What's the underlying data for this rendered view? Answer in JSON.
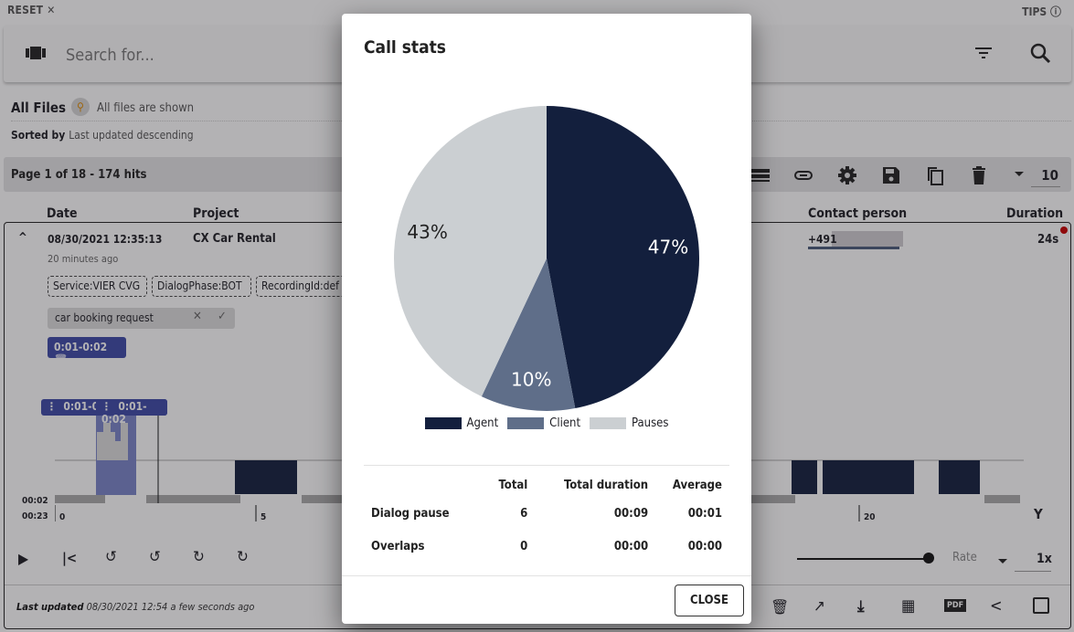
{
  "header": {
    "reset_label": "RESET",
    "tips_label": "TIPS"
  },
  "search": {
    "placeholder": "Search for..."
  },
  "files": {
    "title": "All Files",
    "status": "All files are shown",
    "sorted_by_label": "Sorted by",
    "sorted_by_value": "Last updated descending"
  },
  "pagination": {
    "summary": "Page 1 of 18 - 174 hits",
    "page_size": "10"
  },
  "table": {
    "columns": [
      "Date",
      "Project",
      "Contact person",
      "Duration"
    ],
    "row": {
      "date": "08/30/2021 12:35:13",
      "relative_time": "20 minutes ago",
      "project": "CX Car Rental",
      "contact": "+491",
      "duration": "24s",
      "chips": [
        "Service:VIER CVG",
        "DialogPhase:BOT",
        "RecordingId:def"
      ],
      "tag_text": "car  booking request",
      "segment": "0:01-0:02",
      "segment_marker": "0:01-0:02"
    }
  },
  "timeline": {
    "time_top": "00:02",
    "time_bottom": "00:23",
    "ticks": [
      "0",
      "5",
      "20"
    ]
  },
  "player": {
    "rate_label": "Rate",
    "rate_value": "1x",
    "volume": 1.0
  },
  "footer": {
    "last_updated_label": "Last updated",
    "last_updated_value": "08/30/2021 12:54 a few seconds ago"
  },
  "modal": {
    "title": "Call stats",
    "close_label": "CLOSE",
    "table": {
      "headers": [
        "",
        "Total",
        "Total duration",
        "Average"
      ],
      "rows": [
        {
          "label": "Dialog pause",
          "total": "6",
          "duration": "00:09",
          "average": "00:01"
        },
        {
          "label": "Overlaps",
          "total": "0",
          "duration": "00:00",
          "average": "00:00"
        }
      ]
    }
  },
  "chart_data": {
    "type": "pie",
    "title": "Call stats",
    "categories": [
      "Agent",
      "Client",
      "Pauses"
    ],
    "values": [
      47,
      10,
      43
    ],
    "labels": [
      "47%",
      "10%",
      "43%"
    ],
    "colors": [
      "#131f3d",
      "#5f6e89",
      "#cbcfd2"
    ],
    "legend": "bottom",
    "start_angle": "top, clockwise"
  }
}
